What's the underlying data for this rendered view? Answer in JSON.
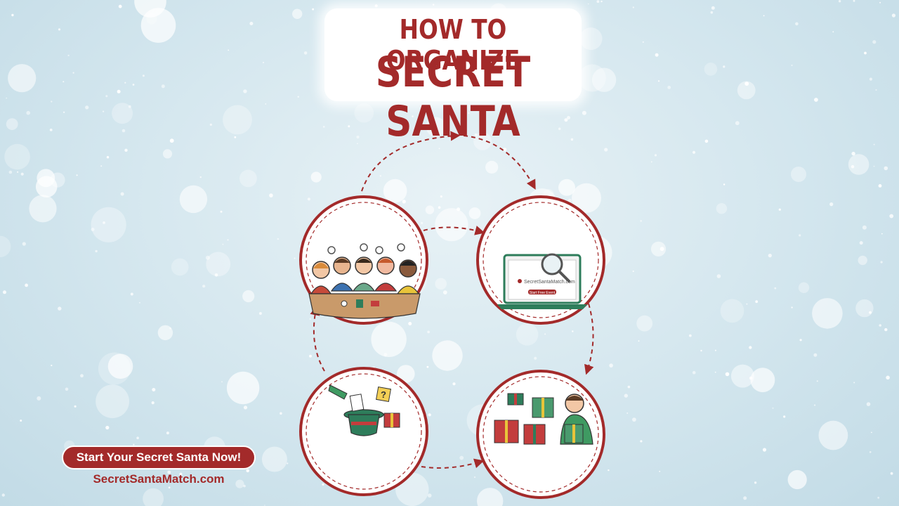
{
  "title": {
    "line1": "HOW TO ORGANIZE",
    "line2": "SECRET SANTA"
  },
  "screen_text": {
    "url": "SecretSantaMatch.com",
    "button": "Start Free Event"
  },
  "cta": {
    "button_label": "Start Your Secret Santa Now!",
    "website": "SecretSantaMatch.com"
  },
  "colors": {
    "brand_red": "#a32a2a",
    "green": "#2e7d5b",
    "background": "#d3e6ee"
  }
}
